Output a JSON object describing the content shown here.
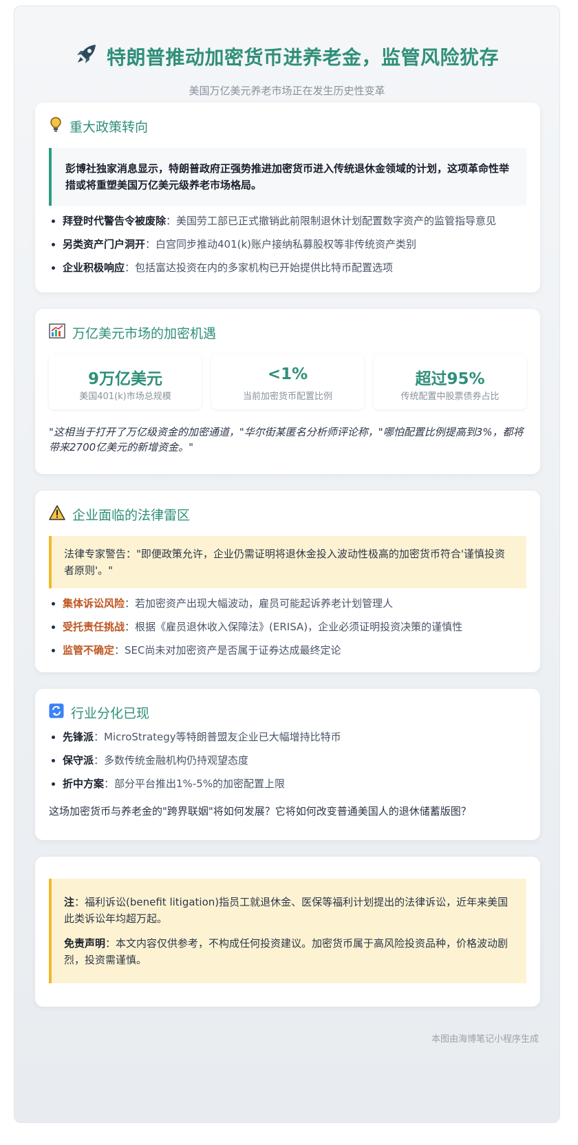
{
  "header": {
    "title": "特朗普推动加密货币进养老金，监管风险犹存",
    "subtitle": "美国万亿美元养老市场正在发生历史性变革"
  },
  "policy": {
    "heading": "重大政策转向",
    "quote": "彭博社独家消息显示，特朗普政府正强势推进加密货币进入传统退休金领域的计划，这项革命性举措或将重塑美国万亿美元级养老市场格局。",
    "items": [
      {
        "label": "拜登时代警告令被废除",
        "text": "：美国劳工部已正式撤销此前限制退休计划配置数字资产的监管指导意见"
      },
      {
        "label": "另类资产门户洞开",
        "text": "：白宫同步推动401(k)账户接纳私募股权等非传统资产类别"
      },
      {
        "label": "企业积极响应",
        "text": "：包括富达投资在内的多家机构已开始提供比特币配置选项"
      }
    ]
  },
  "market": {
    "heading": "万亿美元市场的加密机遇",
    "stats": [
      {
        "value": "9万亿美元",
        "label": "美国401(k)市场总规模"
      },
      {
        "value": "<1%",
        "label": "当前加密货币配置比例"
      },
      {
        "value": "超过95%",
        "label": "传统配置中股票债券占比"
      }
    ],
    "quote": "\"这相当于打开了万亿级资金的加密通道，\"华尔街某匿名分析师评论称，\"哪怕配置比例提高到3%，都将带来2700亿美元的新增资金。\""
  },
  "legal": {
    "heading": "企业面临的法律雷区",
    "warning": "法律专家警告：\"即便政策允许，企业仍需证明将退休金投入波动性极高的加密货币符合'谨慎投资者原则'。\"",
    "items": [
      {
        "label": "集体诉讼风险",
        "text": "：若加密资产出现大幅波动，雇员可能起诉养老计划管理人"
      },
      {
        "label": "受托责任挑战",
        "text": "：根据《雇员退休收入保障法》(ERISA)，企业必须证明投资决策的谨慎性"
      },
      {
        "label": "监管不确定",
        "text": "：SEC尚未对加密资产是否属于证券达成最终定论"
      }
    ]
  },
  "industry": {
    "heading": "行业分化已现",
    "items": [
      {
        "label": "先锋派",
        "text": "：MicroStrategy等特朗普盟友企业已大幅增持比特币"
      },
      {
        "label": "保守派",
        "text": "：多数传统金融机构仍持观望态度"
      },
      {
        "label": "折中方案",
        "text": "：部分平台推出1%-5%的加密配置上限"
      }
    ],
    "closing": "这场加密货币与养老金的\"跨界联姻\"将如何发展？它将如何改变普通美国人的退休储蓄版图？"
  },
  "notes": {
    "note_label": "注",
    "note_text": "：福利诉讼(benefit litigation)指员工就退休金、医保等福利计划提出的法律诉讼，近年来美国此类诉讼年均超万起。",
    "disclaimer_label": "免责声明",
    "disclaimer_text": "：本文内容仅供参考，不构成任何投资建议。加密货币属于高风险投资品种，价格波动剧烈，投资需谨慎。"
  },
  "footer": "本图由海博笔记小程序生成",
  "icons": {
    "title": "rocket-icon",
    "policy": "lightbulb-icon",
    "market": "chart-icon",
    "legal": "warning-icon",
    "industry": "refresh-icon"
  },
  "colors": {
    "accent": "#2f8f7a",
    "warning_text": "#c05621",
    "note_bg": "#fdf3d3"
  }
}
